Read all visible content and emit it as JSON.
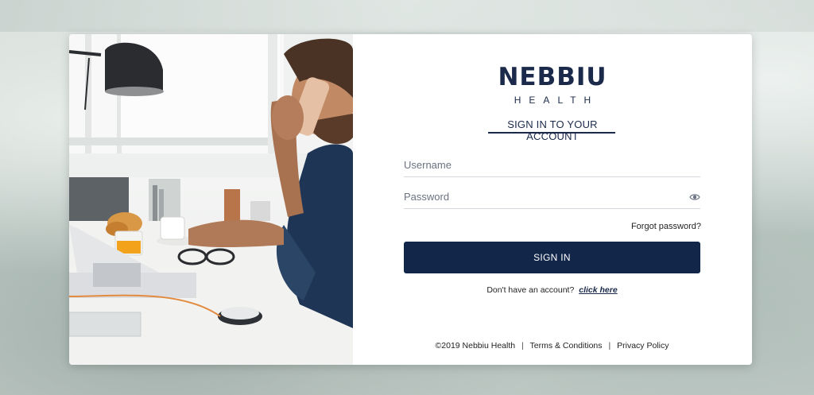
{
  "brand": {
    "name": "NEBBIU",
    "sub": "HEALTH"
  },
  "form": {
    "heading": "SIGN IN TO YOUR ACCOUNT",
    "username_placeholder": "Username",
    "password_placeholder": "Password",
    "forgot_label": "Forgot password?",
    "submit_label": "SIGN IN",
    "signup_text": "Don't have an account?",
    "signup_link": "click here"
  },
  "footer": {
    "copyright": "©2019 Nebbiu Health",
    "terms": "Terms & Conditions",
    "privacy": "Privacy Policy",
    "separator": "|"
  },
  "colors": {
    "primary": "#12264a",
    "text": "#1b2a4a"
  },
  "icons": {
    "password_toggle": "eye-icon"
  }
}
